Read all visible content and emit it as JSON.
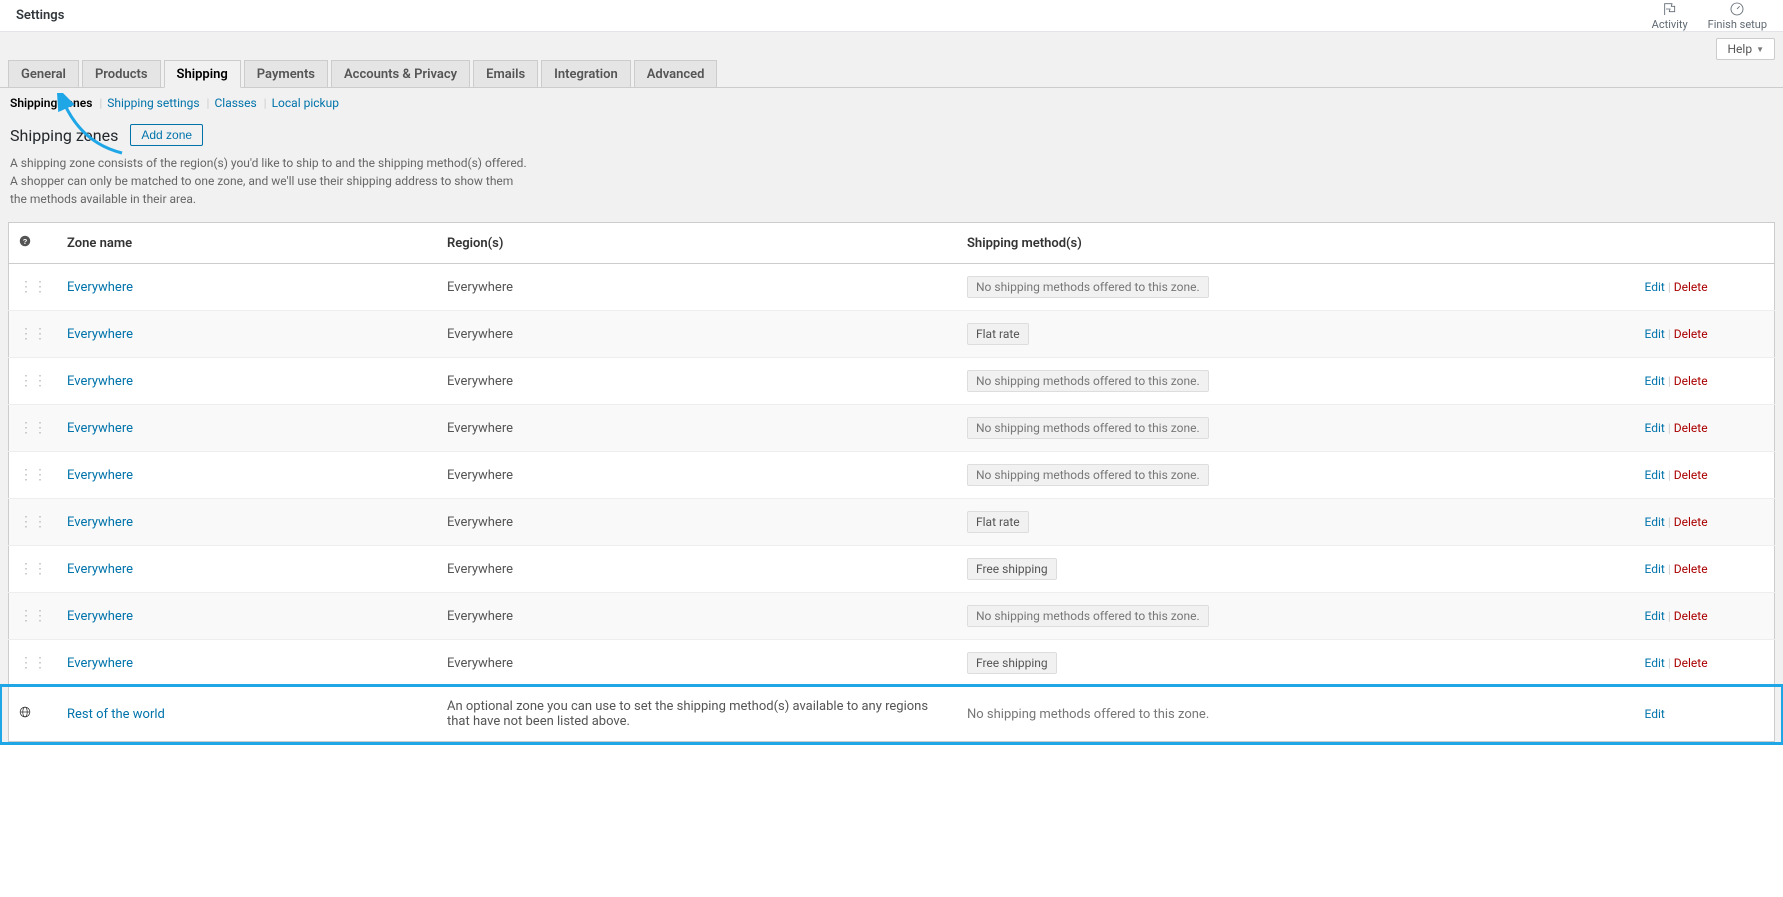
{
  "header": {
    "title": "Settings",
    "activity": "Activity",
    "finish_setup": "Finish setup"
  },
  "help_tab": "Help",
  "tabs": [
    {
      "label": "General",
      "active": false
    },
    {
      "label": "Products",
      "active": false
    },
    {
      "label": "Shipping",
      "active": true
    },
    {
      "label": "Payments",
      "active": false
    },
    {
      "label": "Accounts & Privacy",
      "active": false
    },
    {
      "label": "Emails",
      "active": false
    },
    {
      "label": "Integration",
      "active": false
    },
    {
      "label": "Advanced",
      "active": false
    }
  ],
  "subnav": {
    "zones": "Shipping zones",
    "settings": "Shipping settings",
    "classes": "Classes",
    "pickup": "Local pickup"
  },
  "page": {
    "heading": "Shipping zones",
    "add_zone": "Add zone",
    "description": "A shipping zone consists of the region(s) you'd like to ship to and the shipping method(s) offered. A shopper can only be matched to one zone, and we'll use their shipping address to show them the methods available in their area."
  },
  "table": {
    "cols": {
      "zone": "Zone name",
      "region": "Region(s)",
      "methods": "Shipping method(s)"
    },
    "actions": {
      "edit": "Edit",
      "delete": "Delete"
    },
    "method_none": "No shipping methods offered to this zone.",
    "rows": [
      {
        "name": "Everywhere",
        "region": "Everywhere",
        "methods": [],
        "alt": false
      },
      {
        "name": "Everywhere",
        "region": "Everywhere",
        "methods": [
          "Flat rate"
        ],
        "alt": true
      },
      {
        "name": "Everywhere",
        "region": "Everywhere",
        "methods": [],
        "alt": false
      },
      {
        "name": "Everywhere",
        "region": "Everywhere",
        "methods": [],
        "alt": true
      },
      {
        "name": "Everywhere",
        "region": "Everywhere",
        "methods": [],
        "alt": false
      },
      {
        "name": "Everywhere",
        "region": "Everywhere",
        "methods": [
          "Flat rate"
        ],
        "alt": true
      },
      {
        "name": "Everywhere",
        "region": "Everywhere",
        "methods": [
          "Free shipping"
        ],
        "alt": false
      },
      {
        "name": "Everywhere",
        "region": "Everywhere",
        "methods": [],
        "alt": true
      },
      {
        "name": "Everywhere",
        "region": "Everywhere",
        "methods": [
          "Free shipping"
        ],
        "alt": false
      }
    ],
    "rest": {
      "name": "Rest of the world",
      "region": "An optional zone you can use to set the shipping method(s) available to any regions that have not been listed above.",
      "method": "No shipping methods offered to this zone."
    }
  }
}
